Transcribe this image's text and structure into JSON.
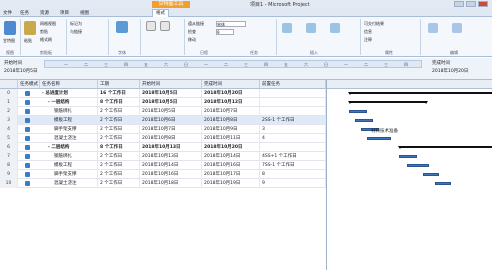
{
  "titlebar": {
    "tool_tab": "甘特图工具",
    "title": "项目1 - Microsoft Project"
  },
  "tabs": [
    "文件",
    "任务",
    "资源",
    "项目",
    "视图",
    "格式"
  ],
  "ribbon": {
    "view_btn": "甘特图",
    "paste_btn": "粘贴",
    "small_btns": [
      "网格视图",
      "剪贴",
      "格式刷",
      "标记为",
      "与链接"
    ],
    "groups": [
      "视图",
      "剪贴板",
      "字体",
      "日程",
      "任务",
      "插入",
      "属性",
      "编辑"
    ],
    "font": "宋体",
    "font_size": "9",
    "buttons": [
      "遵从链接",
      "检查",
      "移动",
      "手动安排",
      "自动安排",
      "检查",
      "移动",
      "模式",
      "任务",
      "里程碑",
      "可交付结果",
      "信息",
      "注释",
      "详细信息",
      "添加到日程表",
      "滚动到任务",
      "查找",
      "清除",
      "填充"
    ],
    "labels": [
      "转到",
      "查看"
    ]
  },
  "timeline": {
    "start_label": "开始时间",
    "start_date": "2018年10月5日",
    "end_label": "完成时间",
    "end_date": "2018年10月20日",
    "scale": [
      "一",
      "二",
      "三",
      "四",
      "五",
      "六",
      "日",
      "一",
      "二",
      "三",
      "四",
      "五",
      "六",
      "日",
      "一",
      "二",
      "三",
      "四"
    ]
  },
  "grid": {
    "headers": [
      "",
      "任务模式",
      "任务名称",
      "工期",
      "开始时间",
      "完成时间",
      "前置任务"
    ],
    "rows": [
      {
        "n": "0",
        "name": "- 总进度计划",
        "dur": "16 个工作日",
        "start": "2018年10月5日",
        "finish": "2018年10月20日",
        "pred": ""
      },
      {
        "n": "1",
        "name": "- 一层结构",
        "dur": "8 个工作日",
        "start": "2018年10月5日",
        "finish": "2018年10月12日",
        "pred": ""
      },
      {
        "n": "2",
        "name": "钢筋绑扎",
        "dur": "2 个工作日",
        "start": "2018年10月5日",
        "finish": "2018年10月7日",
        "pred": ""
      },
      {
        "n": "3",
        "name": "模板工程",
        "dur": "2 个工作日",
        "start": "2018年10月6日",
        "finish": "2018年10月8日",
        "pred": "2SS-1 个工作日"
      },
      {
        "n": "4",
        "name": "脚手架支撑",
        "dur": "2 个工作日",
        "start": "2018年10月7日",
        "finish": "2018年10月9日",
        "pred": "3"
      },
      {
        "n": "5",
        "name": "混凝土浇注",
        "dur": "2 个工作日",
        "start": "2018年10月8日",
        "finish": "2018年10月11日",
        "pred": "4"
      },
      {
        "n": "6",
        "name": "- 二层结构",
        "dur": "8 个工作日",
        "start": "2018年10月13日",
        "finish": "2018年10月20日",
        "pred": ""
      },
      {
        "n": "7",
        "name": "钢筋绑扎",
        "dur": "2 个工作日",
        "start": "2018年10月13日",
        "finish": "2018年10月14日",
        "pred": "4SS+1 个工作日"
      },
      {
        "n": "8",
        "name": "模板工程",
        "dur": "2 个工作日",
        "start": "2018年10月14日",
        "finish": "2018年10月16日",
        "pred": "7SS-1 个工作日"
      },
      {
        "n": "9",
        "name": "脚手架支撑",
        "dur": "2 个工作日",
        "start": "2018年10月16日",
        "finish": "2018年10月17日",
        "pred": "8"
      },
      {
        "n": "10",
        "name": "混凝土浇注",
        "dur": "2 个工作日",
        "start": "2018年10月18日",
        "finish": "2018年10月19日",
        "pred": "9"
      }
    ]
  },
  "gantt": {
    "label": "材料技术准备"
  }
}
